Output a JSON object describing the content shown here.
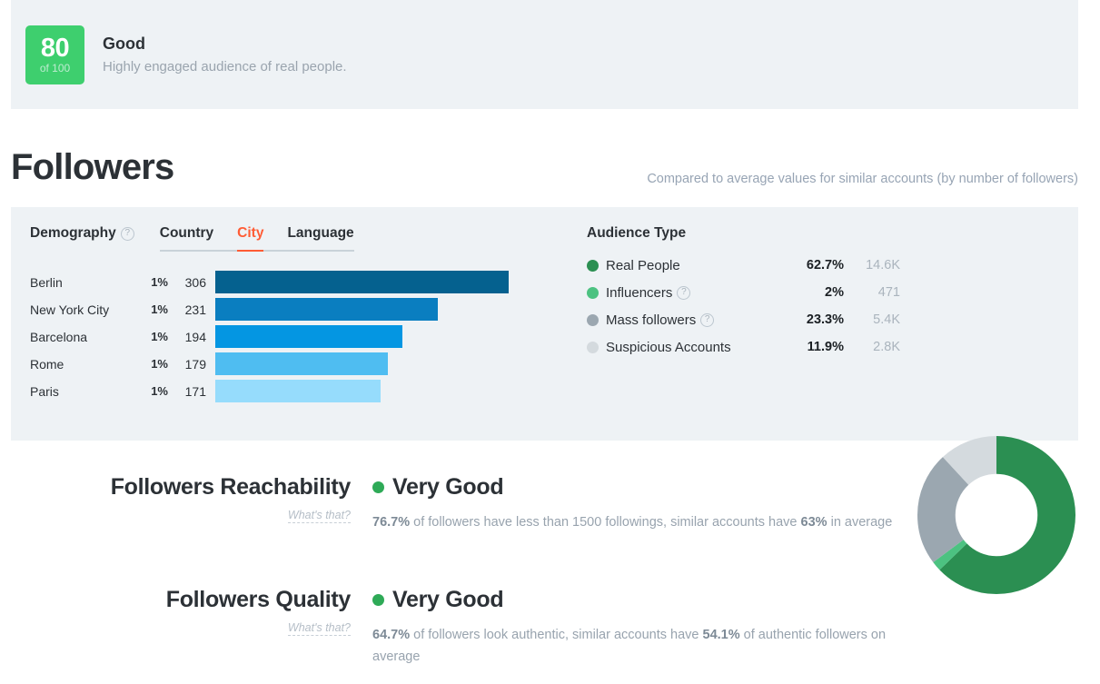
{
  "score": {
    "value": "80",
    "of": "of 100",
    "title": "Good",
    "subtitle": "Highly engaged audience of real people.",
    "badge_color": "#3ecf6e"
  },
  "section": {
    "title": "Followers",
    "note": "Compared to average values for similar accounts (by number of followers)"
  },
  "demography": {
    "label": "Demography",
    "help": "?",
    "tabs": [
      {
        "label": "Country",
        "active": false
      },
      {
        "label": "City",
        "active": true
      },
      {
        "label": "Language",
        "active": false
      }
    ],
    "active_tab": "City",
    "rows": [
      {
        "name": "Berlin",
        "pct": "1%",
        "value": "306",
        "color": "#05618f"
      },
      {
        "name": "New York City",
        "pct": "1%",
        "value": "231",
        "color": "#0a7ec0"
      },
      {
        "name": "Barcelona",
        "pct": "1%",
        "value": "194",
        "color": "#0496e2"
      },
      {
        "name": "Rome",
        "pct": "1%",
        "value": "179",
        "color": "#4fbdf1"
      },
      {
        "name": "Paris",
        "pct": "1%",
        "value": "171",
        "color": "#96dcfc"
      }
    ]
  },
  "audience": {
    "title": "Audience Type",
    "rows": [
      {
        "name": "Real People",
        "pct": "62.7%",
        "count": "14.6K",
        "color": "#2b8f52",
        "help": ""
      },
      {
        "name": "Influencers",
        "pct": "2%",
        "count": "471",
        "color": "#4cc281",
        "help": "?"
      },
      {
        "name": "Mass followers",
        "pct": "23.3%",
        "count": "5.4K",
        "color": "#9ba7b0",
        "help": "?"
      },
      {
        "name": "Suspicious Accounts",
        "pct": "11.9%",
        "count": "2.8K",
        "color": "#d4dade",
        "help": ""
      }
    ]
  },
  "chart_data": [
    {
      "type": "bar",
      "title": "Demography by City",
      "categories": [
        "Berlin",
        "New York City",
        "Barcelona",
        "Rome",
        "Paris"
      ],
      "values": [
        306,
        231,
        194,
        179,
        171
      ],
      "percent_labels": [
        "1%",
        "1%",
        "1%",
        "1%",
        "1%"
      ],
      "colors": [
        "#05618f",
        "#0a7ec0",
        "#0496e2",
        "#4fbdf1",
        "#96dcfc"
      ],
      "orientation": "horizontal",
      "xlabel": "",
      "ylabel": "",
      "xlim": [
        0,
        306
      ],
      "grid": false,
      "legend": "none"
    },
    {
      "type": "pie",
      "title": "Audience Type",
      "donut": true,
      "start_angle": 0,
      "labels": [
        "Real People",
        "Influencers",
        "Mass followers",
        "Suspicious Accounts"
      ],
      "values": [
        62.7,
        2,
        23.3,
        11.9
      ],
      "counts": [
        "14.6K",
        "471",
        "5.4K",
        "2.8K"
      ],
      "colors": [
        "#2b8f52",
        "#4cc281",
        "#9ba7b0",
        "#d4dade"
      ],
      "legend": "left"
    }
  ],
  "metrics": [
    {
      "name": "Followers Reachability",
      "whats_that": "What's that?",
      "verdict": "Very Good",
      "verdict_color": "#2eaa57",
      "desc_parts": [
        {
          "text": "76.7%",
          "bold": true
        },
        {
          "text": " of followers have less than 1500 followings, similar accounts have ",
          "bold": false
        },
        {
          "text": "63%",
          "bold": true
        },
        {
          "text": " in average",
          "bold": false
        }
      ]
    },
    {
      "name": "Followers Quality",
      "whats_that": "What's that?",
      "verdict": "Very Good",
      "verdict_color": "#2eaa57",
      "desc_parts": [
        {
          "text": "64.7%",
          "bold": true
        },
        {
          "text": " of followers look authentic, similar accounts have ",
          "bold": false
        },
        {
          "text": "54.1%",
          "bold": true
        },
        {
          "text": " of authentic followers on average",
          "bold": false
        }
      ]
    }
  ]
}
